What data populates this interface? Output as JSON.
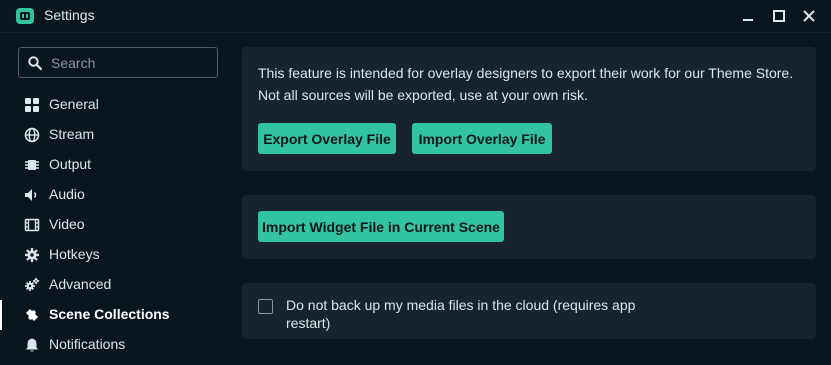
{
  "window": {
    "title": "Settings",
    "controls": [
      "minimize-icon",
      "maximize-icon",
      "close-icon"
    ]
  },
  "search": {
    "placeholder": "Search",
    "value": ""
  },
  "sidebar": {
    "items": [
      {
        "label": "General",
        "icon": "grid-icon"
      },
      {
        "label": "Stream",
        "icon": "globe-icon"
      },
      {
        "label": "Output",
        "icon": "chip-icon"
      },
      {
        "label": "Audio",
        "icon": "speaker-icon"
      },
      {
        "label": "Video",
        "icon": "film-icon"
      },
      {
        "label": "Hotkeys",
        "icon": "gear-icon"
      },
      {
        "label": "Advanced",
        "icon": "cogs-icon"
      },
      {
        "label": "Scene Collections",
        "icon": "puzzle-icon"
      },
      {
        "label": "Notifications",
        "icon": "bell-icon"
      }
    ],
    "active_index": 7
  },
  "overlay_panel": {
    "description_line1": "This feature is intended for overlay designers to export their work for our Theme Store.",
    "description_line2": "Not all sources will be exported, use at your own risk.",
    "export_button": "Export Overlay File",
    "import_button": "Import Overlay File"
  },
  "widget_panel": {
    "import_widget_button": "Import Widget File in Current Scene"
  },
  "backup_panel": {
    "checkbox_label": "Do not back up my media files in the cloud (requires app restart)",
    "checked": false
  },
  "colors": {
    "background": "#09161d",
    "panel": "#17242d",
    "accent": "#31c3a2",
    "text": "#dde6ea"
  }
}
